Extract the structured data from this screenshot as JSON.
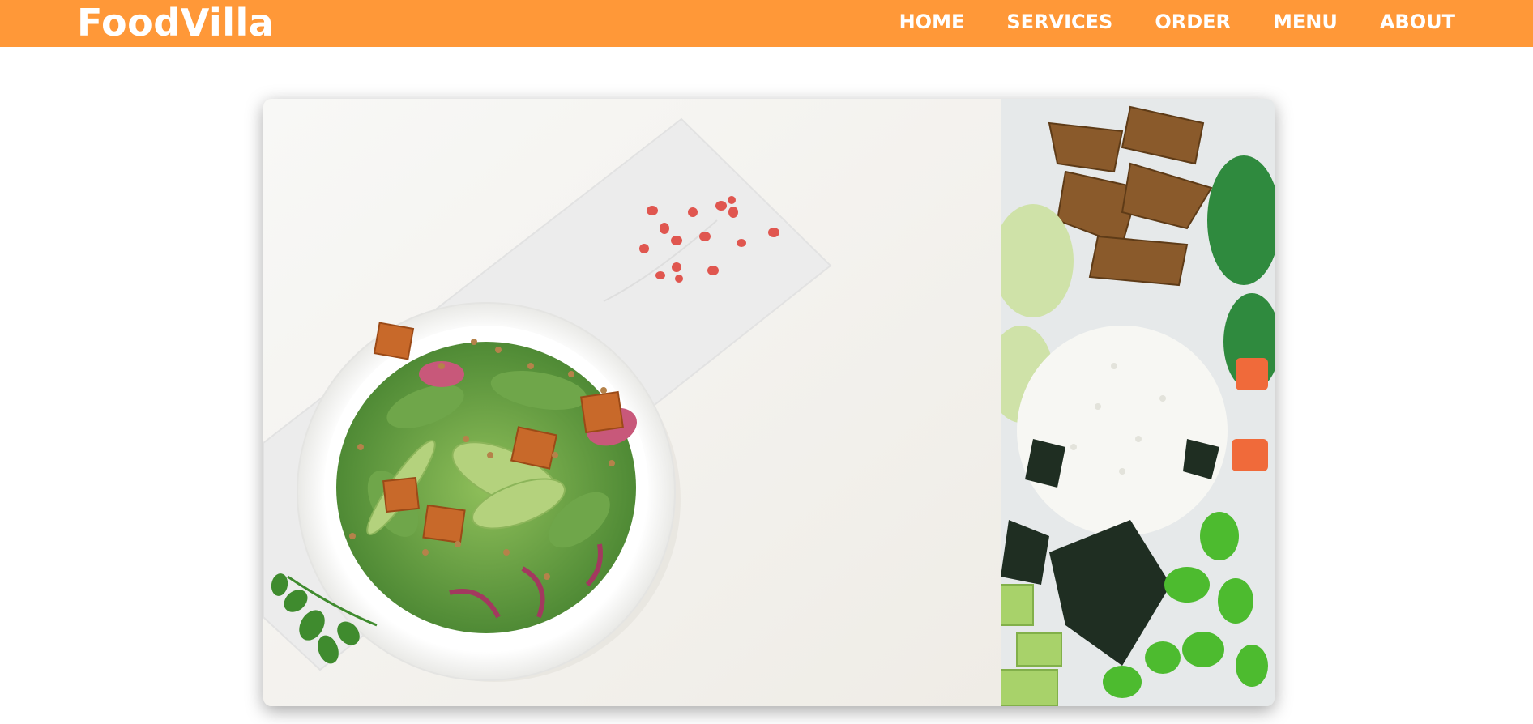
{
  "header": {
    "brand": "FoodVilla",
    "nav": [
      {
        "label": "HOME"
      },
      {
        "label": "SERVICES"
      },
      {
        "label": "ORDER"
      },
      {
        "label": "MENU"
      },
      {
        "label": "ABOUT"
      }
    ],
    "bg_color": "#ff9838",
    "text_color": "#ffffff"
  },
  "carousel": {
    "slides": [
      {
        "image": "salad-bowl-photo"
      },
      {
        "image": "poke-bowl-photo"
      }
    ]
  }
}
